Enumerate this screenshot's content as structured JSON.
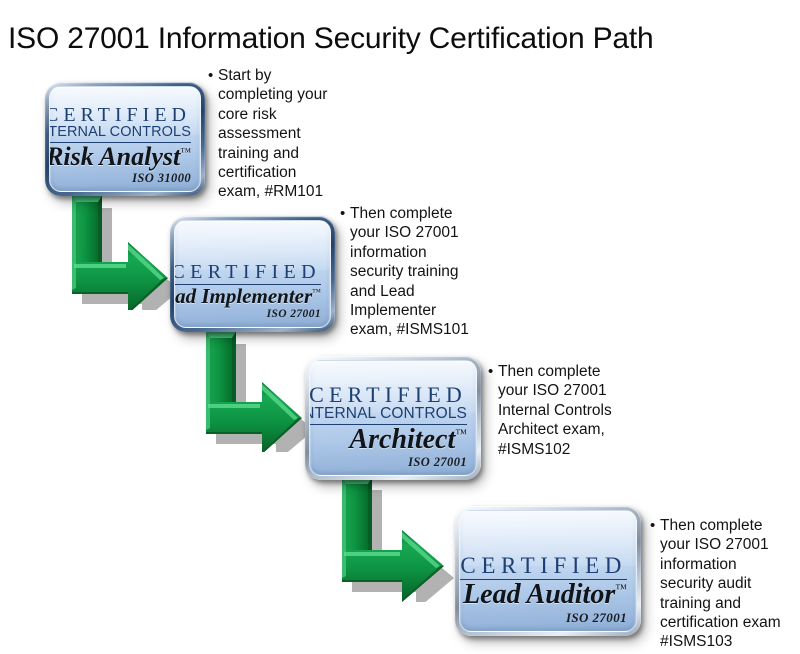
{
  "title": "ISO 27001 Information Security Certification Path",
  "colors": {
    "background": "#ffffff",
    "title_text": "#0d0d0d",
    "badge_text_blue": "#1d3f72",
    "badge_face_light": "#eef5fd",
    "badge_face_dark": "#8fafd6",
    "badge_frame_silver": "#aab6c4",
    "arrow_green_face": "#00a64a",
    "arrow_green_dark": "#00712f",
    "arrow_green_light": "#46cf7d",
    "bullet_text": "#131313"
  },
  "steps": [
    {
      "id": "risk-analyst",
      "badge": {
        "certified_label": "CERTIFIED",
        "internal_controls_label": "INTERNAL CONTROLS",
        "credential_name": "Risk Analyst",
        "trademark": "™",
        "standard": "ISO 31000"
      },
      "note": "Start by completing your core risk assessment training and certification exam, #RM101",
      "exam_code": "#RM101"
    },
    {
      "id": "lead-implementer",
      "badge": {
        "certified_label": "CERTIFIED",
        "internal_controls_label": "",
        "credential_name": "Lead Implementer",
        "trademark": "™",
        "standard": "ISO 27001"
      },
      "note": "Then complete your ISO 27001 information security training and Lead Implementer exam, #ISMS101",
      "exam_code": "#ISMS101"
    },
    {
      "id": "architect",
      "badge": {
        "certified_label": "CERTIFIED",
        "internal_controls_label": "INTERNAL CONTROLS",
        "credential_name": "Architect",
        "trademark": "™",
        "standard": "ISO 27001"
      },
      "note": "Then complete your ISO 27001 Internal Controls Architect exam, #ISMS102",
      "exam_code": "#ISMS102"
    },
    {
      "id": "lead-auditor",
      "badge": {
        "certified_label": "CERTIFIED",
        "internal_controls_label": "",
        "credential_name": "Lead Auditor",
        "trademark": "™",
        "standard": "ISO 27001"
      },
      "note": "Then complete your ISO 27001 information security audit training and certification exam #ISMS103",
      "exam_code": "#ISMS103"
    }
  ],
  "connectors": [
    {
      "id": "arrow-1",
      "from": "risk-analyst",
      "to": "lead-implementer",
      "shape": "elbow-down-right"
    },
    {
      "id": "arrow-2",
      "from": "lead-implementer",
      "to": "architect",
      "shape": "elbow-down-right"
    },
    {
      "id": "arrow-3",
      "from": "architect",
      "to": "lead-auditor",
      "shape": "elbow-down-right"
    }
  ]
}
